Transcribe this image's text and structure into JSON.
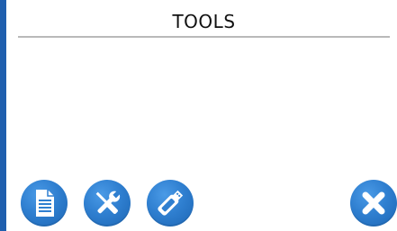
{
  "header": {
    "title": "TOOLS"
  },
  "colors": {
    "accent": "#1f5fae",
    "button_blue": "#2f7fd0",
    "rule": "#b9b9b9"
  },
  "toolbar": {
    "buttons": [
      {
        "icon": "document-icon"
      },
      {
        "icon": "tools-icon"
      },
      {
        "icon": "usb-drive-icon"
      },
      {
        "icon": "close-icon"
      }
    ]
  }
}
